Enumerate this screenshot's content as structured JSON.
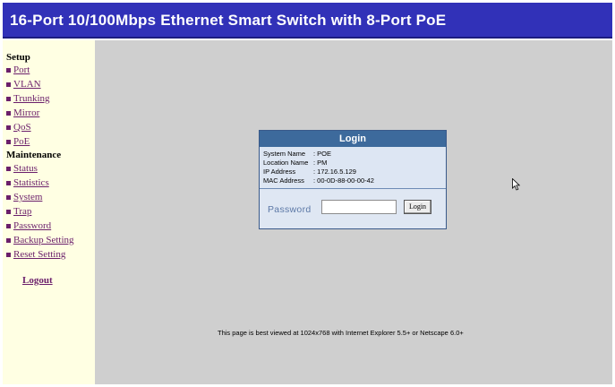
{
  "header": {
    "title": "16-Port 10/100Mbps Ethernet Smart Switch with 8-Port PoE"
  },
  "sidebar": {
    "setup_heading": "Setup",
    "setup_items": [
      {
        "label": "Port"
      },
      {
        "label": "VLAN"
      },
      {
        "label": "Trunking"
      },
      {
        "label": "Mirror"
      },
      {
        "label": "QoS"
      },
      {
        "label": "PoE"
      }
    ],
    "maintenance_heading": "Maintenance",
    "maintenance_items": [
      {
        "label": "Status"
      },
      {
        "label": "Statistics"
      },
      {
        "label": "System"
      },
      {
        "label": "Trap"
      },
      {
        "label": "Password"
      },
      {
        "label": "Backup Setting"
      },
      {
        "label": "Reset Setting"
      }
    ],
    "logout_label": "Logout"
  },
  "login": {
    "title": "Login",
    "info": [
      {
        "label": "System Name",
        "value": ": POE"
      },
      {
        "label": "Location Name",
        "value": ": PM"
      },
      {
        "label": "IP Address",
        "value": ": 172.16.5.129"
      },
      {
        "label": "MAC Address",
        "value": ": 00-0D-88-00-00-42"
      }
    ],
    "password_label": "Password",
    "password_value": "",
    "button_label": "Login"
  },
  "footer": {
    "note": "This page is best viewed at 1024x768 with Internet Explorer 5.5+ or Netscape 6.0+"
  },
  "colors": {
    "header_bg": "#3131b8",
    "sidebar_bg": "#ffffe3",
    "content_bg": "#cfcfcf",
    "link": "#6b1f6b",
    "login_title_bg": "#3d6a9c"
  }
}
